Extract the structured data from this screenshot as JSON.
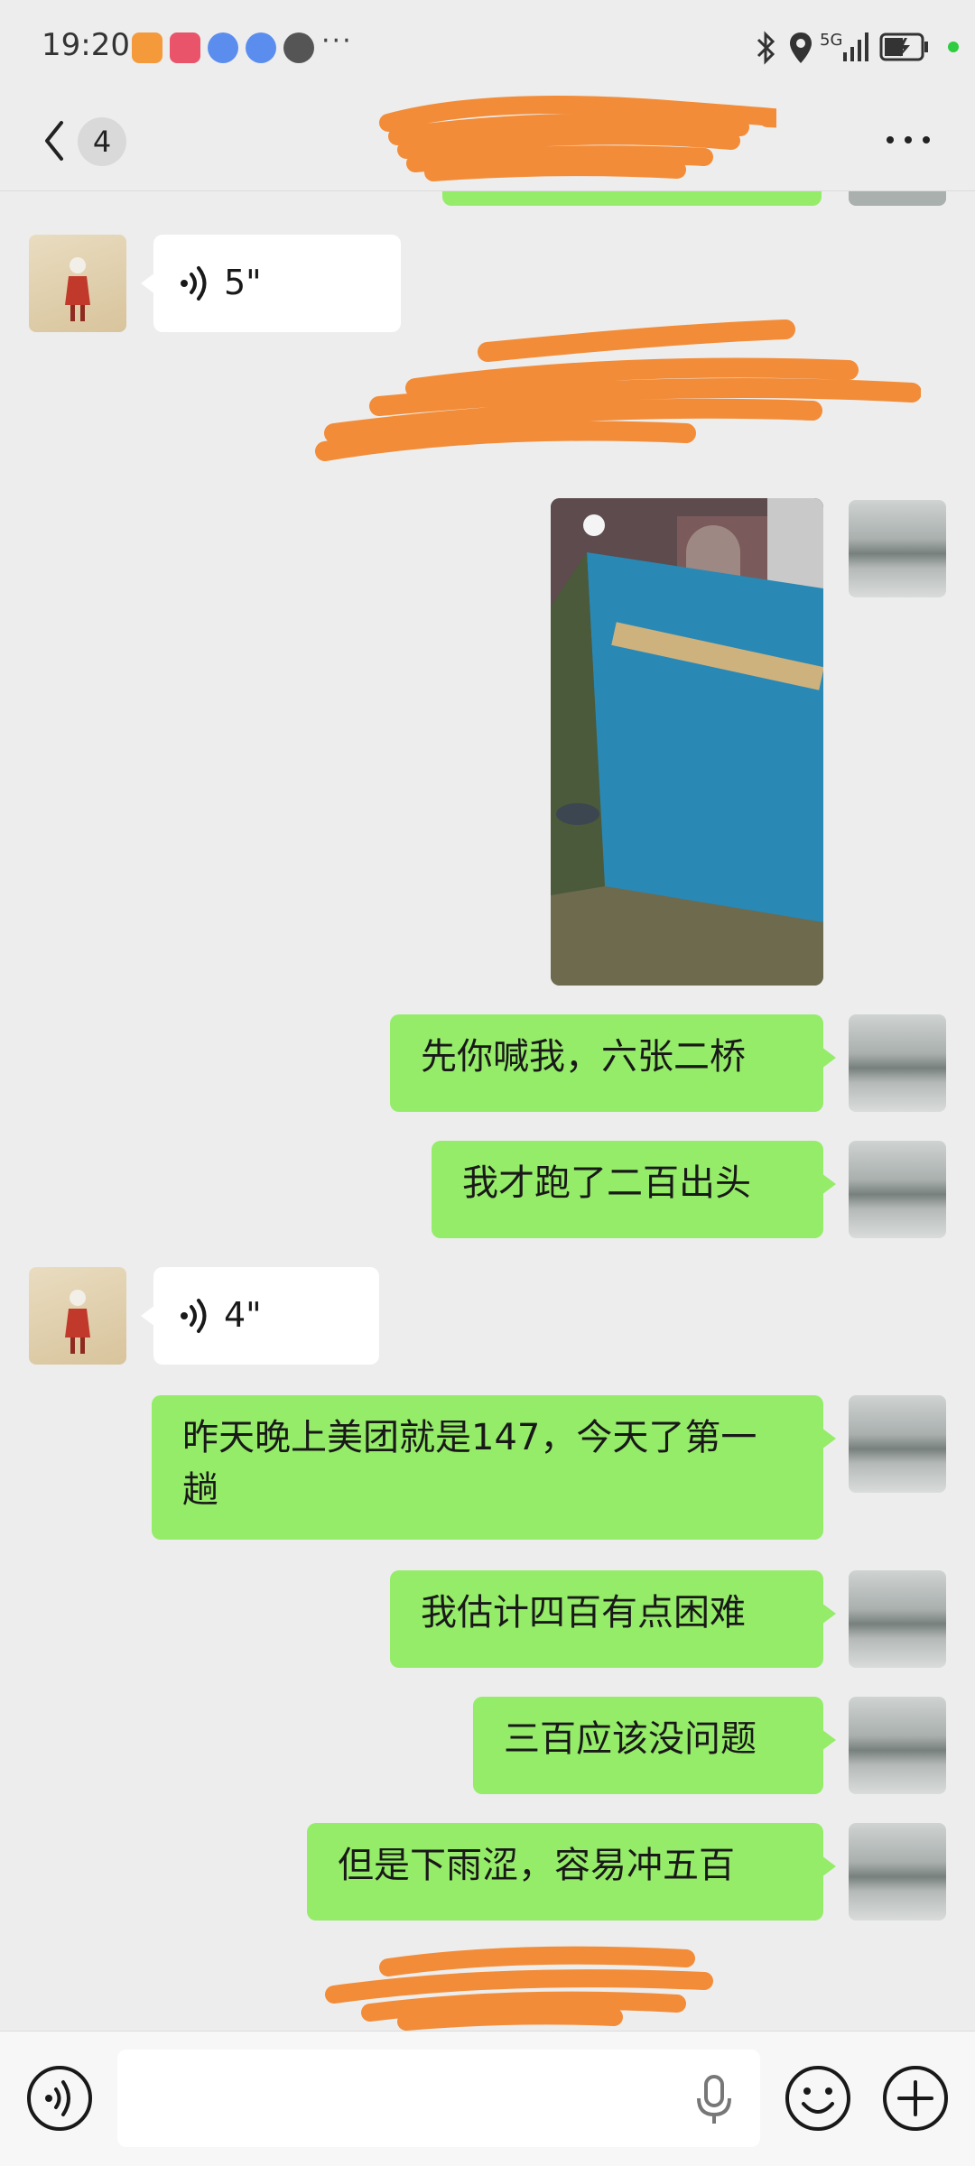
{
  "status_bar": {
    "time": "19:20",
    "more": "···",
    "network": "5G",
    "icons": [
      "bluetooth-icon",
      "location-icon",
      "signal-icon",
      "battery-charging-icon"
    ]
  },
  "header": {
    "unread_count": "4",
    "title": ""
  },
  "messages": [
    {
      "sender": "contact",
      "type": "voice",
      "duration": "5\""
    },
    {
      "sender": "self",
      "type": "image",
      "alt": ""
    },
    {
      "sender": "self",
      "type": "text",
      "text": "先你喊我，六张二桥"
    },
    {
      "sender": "self",
      "type": "text",
      "text": "我才跑了二百出头"
    },
    {
      "sender": "contact",
      "type": "voice",
      "duration": "4\""
    },
    {
      "sender": "self",
      "type": "text",
      "text": "昨天晚上美团就是147，今天了第一趟"
    },
    {
      "sender": "self",
      "type": "text",
      "text": "我估计四百有点困难"
    },
    {
      "sender": "self",
      "type": "text",
      "text": "三百应该没问题"
    },
    {
      "sender": "self",
      "type": "text",
      "text": "但是下雨涩，容易冲五百"
    }
  ],
  "input_bar": {
    "placeholder": ""
  },
  "colors": {
    "background": "#ededed",
    "self_bubble": "#95ec69",
    "contact_bubble": "#ffffff",
    "redaction": "#f28c38"
  }
}
